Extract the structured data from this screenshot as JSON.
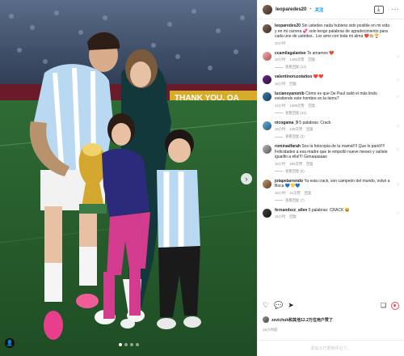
{
  "post": {
    "username": "leoparedes20",
    "follow_label": "关注",
    "next_icon": "›"
  },
  "caption": {
    "username": "leoparedes20",
    "text": "Sin ustedes nada hubiera sido posible en mi vida y en mi carrera 💞 solo tengo palabras de agradecimiento para cada uno de ustedes.. Los amo con toda mi alma ❤️👏🏼🏆",
    "time": "10小时"
  },
  "comments": [
    {
      "user": "ccamilagalantee",
      "text": "Te amamos ❤️",
      "time": "10小时",
      "likes": "1400次赞",
      "reply": "回复",
      "view_replies": "查看回复 (12)"
    },
    {
      "user": "valentinoruzotattoo",
      "text": "❤️❤️",
      "time": "15小时",
      "likes": "",
      "reply": "回复",
      "view_replies": ""
    },
    {
      "user": "lucianoyanonib",
      "text": "Cómo es que De Paul salió el más lindo existiendo este hombre en la tierra?",
      "time": "14小时",
      "likes": "1308次赞",
      "reply": "回复",
      "view_replies": "查看回复 (41)"
    },
    {
      "user": "nicogama_9",
      "text": "5 palabras: Crack",
      "time": "15小时",
      "likes": "128次赞",
      "reply": "回复",
      "view_replies": "查看回复 (3)"
    },
    {
      "user": "rominadfarah",
      "text": "Sos la fotocopia de tu mamá!!!! Que lo parió!!!! Felicidades a esa madre que te empolló nueve meses y salíste iguailto a ella!!!! Genaaaaaas",
      "time": "15小时",
      "likes": "283次赞",
      "reply": "回复",
      "view_replies": "查看回复 (5)"
    },
    {
      "user": "jotapelarrondo",
      "text": "Ya esta crack, son campeón del mundo, volvé a Boca 💙💛💙",
      "time": "15小时",
      "likes": "41次赞",
      "reply": "回复",
      "view_replies": "查看回复 (7)"
    },
    {
      "user": "fernandezz_allen",
      "text": "5 palabras: CRACK 😆",
      "time": "15小时",
      "likes": "",
      "reply": "回复",
      "view_replies": ""
    }
  ],
  "likes": {
    "text": "zevichuk和其他12.2万位用户赞了"
  },
  "date": "16小时前",
  "add_comment": {
    "placeholder": "此帖子已限制评论了。"
  },
  "photo": {
    "banner_text": "THANK YOU, QA"
  }
}
